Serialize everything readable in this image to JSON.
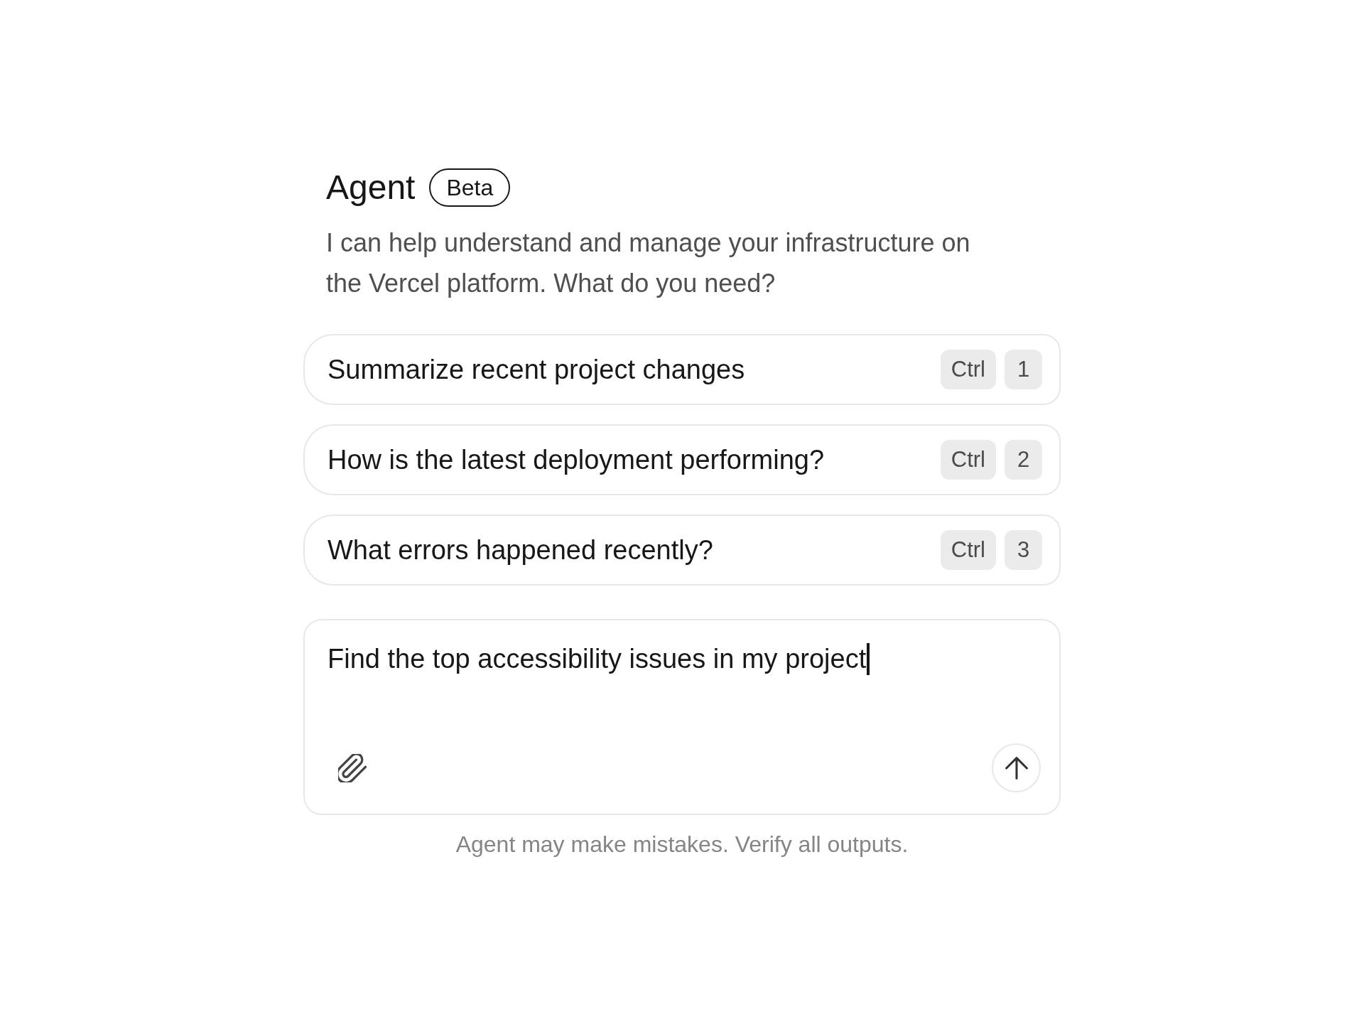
{
  "header": {
    "title": "Agent",
    "badge": "Beta",
    "description": "I can help understand and manage your infrastructure on the Vercel platform. What do you need?"
  },
  "suggestions": [
    {
      "label": "Summarize recent project changes",
      "keys": [
        "Ctrl",
        "1"
      ]
    },
    {
      "label": "How is the latest deployment performing?",
      "keys": [
        "Ctrl",
        "2"
      ]
    },
    {
      "label": "What errors happened recently?",
      "keys": [
        "Ctrl",
        "3"
      ]
    }
  ],
  "composer": {
    "value": "Find the top accessibility issues in my project",
    "focused": true
  },
  "disclaimer": "Agent may make mistakes. Verify all outputs."
}
